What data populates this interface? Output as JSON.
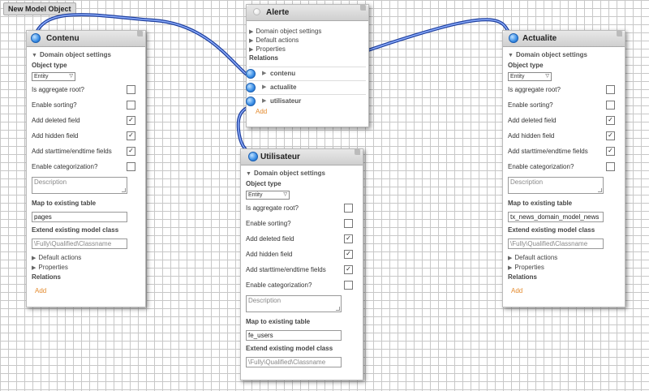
{
  "toolbar": {
    "new_button": "New Model Object"
  },
  "labels": {
    "domain_settings": "Domain object settings",
    "object_type": "Object type",
    "aggregate_root": "Is aggregate root?",
    "enable_sorting": "Enable sorting?",
    "add_deleted": "Add deleted field",
    "add_hidden": "Add hidden field",
    "add_starttime": "Add starttime/endtime fields",
    "enable_categorization": "Enable categorization?",
    "map_table": "Map to existing table",
    "extend_class": "Extend existing model class",
    "default_actions": "Default actions",
    "properties": "Properties",
    "relations": "Relations",
    "add": "Add"
  },
  "nodes": {
    "contenu": {
      "title": "Contenu",
      "object_type": "Entity",
      "checks": {
        "aggregate_root": false,
        "enable_sorting": false,
        "add_deleted": true,
        "add_hidden": true,
        "add_starttime": true,
        "enable_categorization": false
      },
      "description_placeholder": "Description",
      "map_table": "pages",
      "extend_placeholder": "\\Fully\\Qualified\\Classname"
    },
    "actualite": {
      "title": "Actualite",
      "object_type": "Entity",
      "checks": {
        "aggregate_root": false,
        "enable_sorting": false,
        "add_deleted": true,
        "add_hidden": true,
        "add_starttime": true,
        "enable_categorization": false
      },
      "description_placeholder": "Description",
      "map_table": "tx_news_domain_model_news",
      "extend_placeholder": "\\Fully\\Qualified\\Classname"
    },
    "utilisateur": {
      "title": "Utilisateur",
      "object_type": "Entity",
      "checks": {
        "aggregate_root": false,
        "enable_sorting": false,
        "add_deleted": true,
        "add_hidden": true,
        "add_starttime": true,
        "enable_categorization": false
      },
      "description_placeholder": "Description",
      "map_table": "fe_users",
      "extend_placeholder": "\\Fully\\Qualified\\Classname"
    },
    "alerte": {
      "title": "Alerte",
      "relations": [
        "contenu",
        "actualite",
        "utilisateur"
      ]
    }
  },
  "icons": {
    "terminal": "connector-dot-icon",
    "expand": "triangle-right-icon",
    "collapse": "triangle-down-icon",
    "check": "checkmark-icon"
  },
  "colors": {
    "wire": "#2a55c8",
    "add_link": "#e48a2d",
    "terminal": "#3a8ee6"
  }
}
